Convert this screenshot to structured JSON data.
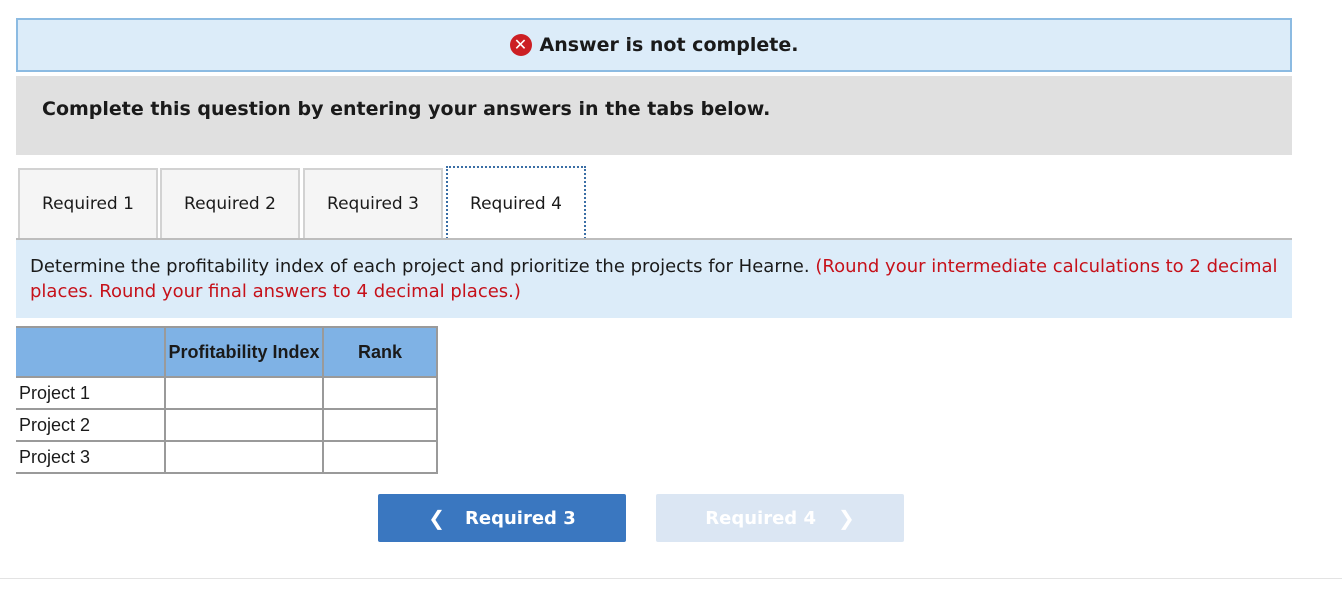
{
  "banner": {
    "icon": "x-circle-icon",
    "message": "Answer is not complete."
  },
  "instructions": "Complete this question by entering your answers in the tabs below.",
  "tabs": [
    {
      "label": "Required 1",
      "active": false
    },
    {
      "label": "Required 2",
      "active": false
    },
    {
      "label": "Required 3",
      "active": false
    },
    {
      "label": "Required 4",
      "active": true
    }
  ],
  "question": {
    "text": "Determine the profitability index of each project and prioritize the projects for Hearne.",
    "note": "(Round your intermediate calculations to 2 decimal places. Round your final answers to 4 decimal places.)"
  },
  "table": {
    "headers": [
      "",
      "Profitability Index",
      "Rank"
    ],
    "rows": [
      {
        "label": "Project 1",
        "profitability_index": "",
        "rank": ""
      },
      {
        "label": "Project 2",
        "profitability_index": "",
        "rank": ""
      },
      {
        "label": "Project 3",
        "profitability_index": "",
        "rank": ""
      }
    ]
  },
  "nav": {
    "prev_label": "Required 3",
    "next_label": "Required 4",
    "prev_icon": "chevron-left-icon",
    "next_icon": "chevron-right-icon"
  },
  "colors": {
    "banner_bg": "#dcecf9",
    "error_red": "#cc1f24",
    "header_blue": "#7fb2e5",
    "button_blue": "#3a77c0",
    "button_disabled": "#dbe6f3"
  }
}
